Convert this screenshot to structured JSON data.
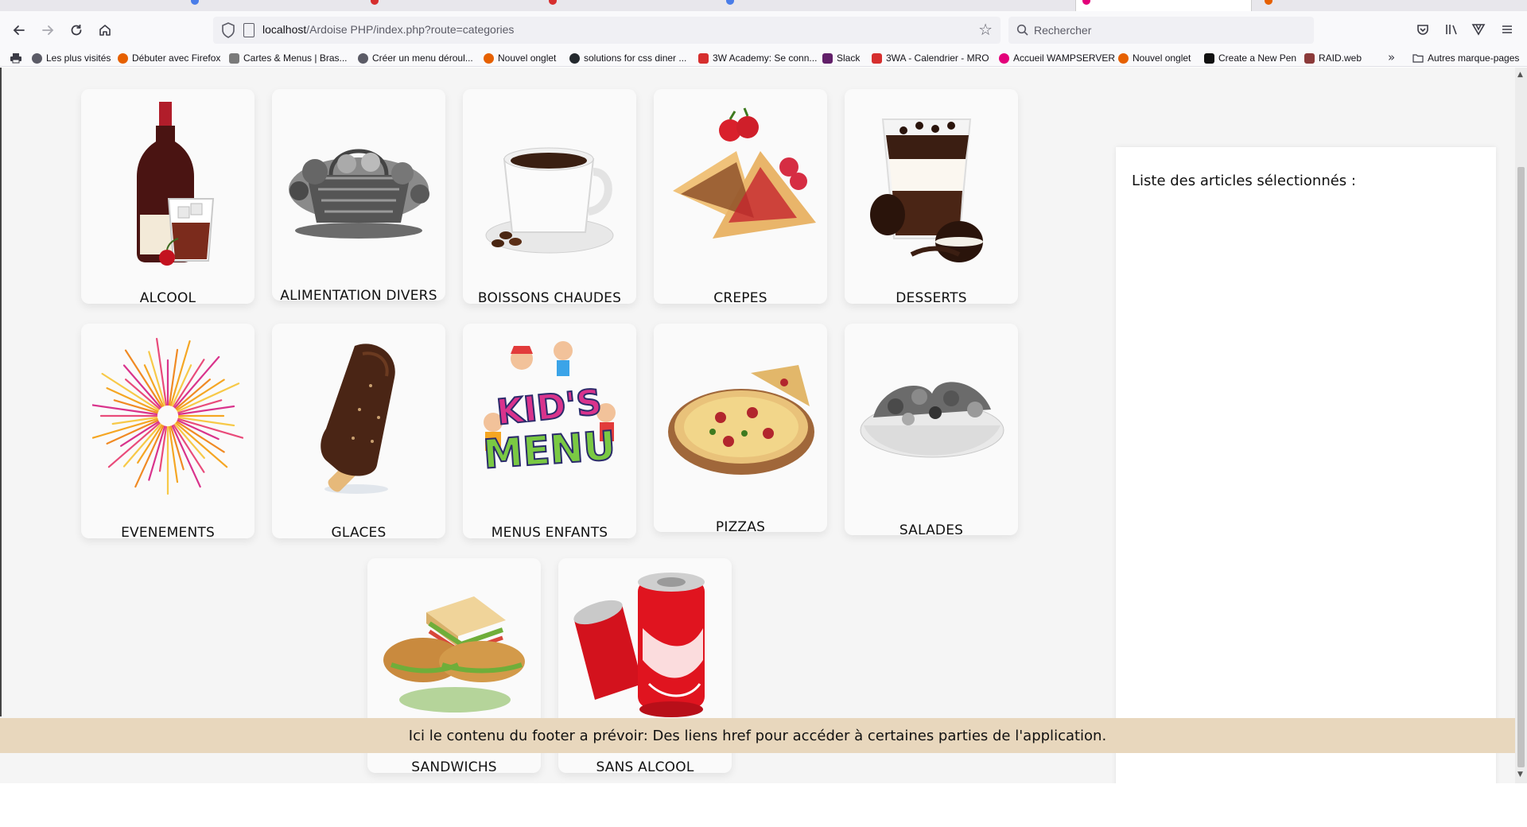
{
  "browser": {
    "url_host": "localhost",
    "url_path": "/Ardoise PHP/index.php?route=categories",
    "search_placeholder": "Rechercher",
    "bookmarks": [
      {
        "label": "Les plus visités",
        "icon": "gear-icon",
        "color": "#5b5b66"
      },
      {
        "label": "Débuter avec Firefox",
        "icon": "firefox-icon",
        "color": "#e66000"
      },
      {
        "label": "Cartes & Menus | Bras...",
        "icon": "menu-site-icon",
        "color": "#7a7a7a"
      },
      {
        "label": "Créer un menu déroul...",
        "icon": "globe-icon",
        "color": "#5b5b66"
      },
      {
        "label": "Nouvel onglet",
        "icon": "firefox-icon",
        "color": "#e66000"
      },
      {
        "label": "solutions for css diner ...",
        "icon": "github-icon",
        "color": "#24292e"
      },
      {
        "label": "3W Academy: Se conn...",
        "icon": "academy-icon",
        "color": "#d62e2e"
      },
      {
        "label": "Slack",
        "icon": "slack-icon",
        "color": "#611f69"
      },
      {
        "label": "3WA - Calendrier - MRO",
        "icon": "academy-icon",
        "color": "#d62e2e"
      },
      {
        "label": "Accueil WAMPSERVER",
        "icon": "wamp-icon",
        "color": "#e3007a"
      },
      {
        "label": "Nouvel onglet",
        "icon": "firefox-icon",
        "color": "#e66000"
      },
      {
        "label": "Create a New Pen",
        "icon": "codepen-icon",
        "color": "#111111"
      },
      {
        "label": "RAID.web",
        "icon": "raid-icon",
        "color": "#8b3a3a"
      }
    ],
    "other_bookmarks": "Autres marque-pages"
  },
  "categories": [
    {
      "label": "ALCOOL",
      "icon": "liquor-bottle-icon"
    },
    {
      "label": "ALIMENTATION DIVERS",
      "icon": "grocery-basket-icon"
    },
    {
      "label": "BOISSONS CHAUDES",
      "icon": "coffee-cup-icon"
    },
    {
      "label": "CREPES",
      "icon": "crepe-icon"
    },
    {
      "label": "DESSERTS",
      "icon": "dessert-cup-icon"
    },
    {
      "label": "EVENEMENTS",
      "icon": "firework-icon"
    },
    {
      "label": "GLACES",
      "icon": "ice-cream-bar-icon"
    },
    {
      "label": "MENUS ENFANTS",
      "icon": "kids-menu-icon"
    },
    {
      "label": "PIZZAS",
      "icon": "pizza-icon"
    },
    {
      "label": "SALADES",
      "icon": "salad-bowl-icon"
    },
    {
      "label": "SANDWICHS",
      "icon": "sandwich-icon"
    },
    {
      "label": "SANS ALCOOL",
      "icon": "soda-can-icon"
    }
  ],
  "kids_menu_logo": {
    "line1": "KID'S",
    "line2": "MENU"
  },
  "sidebar": {
    "title": "Liste des articles sélectionnés :"
  },
  "footer": {
    "text": "Ici le contenu du footer a prévoir: Des liens href pour accéder à certaines parties de l'application."
  }
}
